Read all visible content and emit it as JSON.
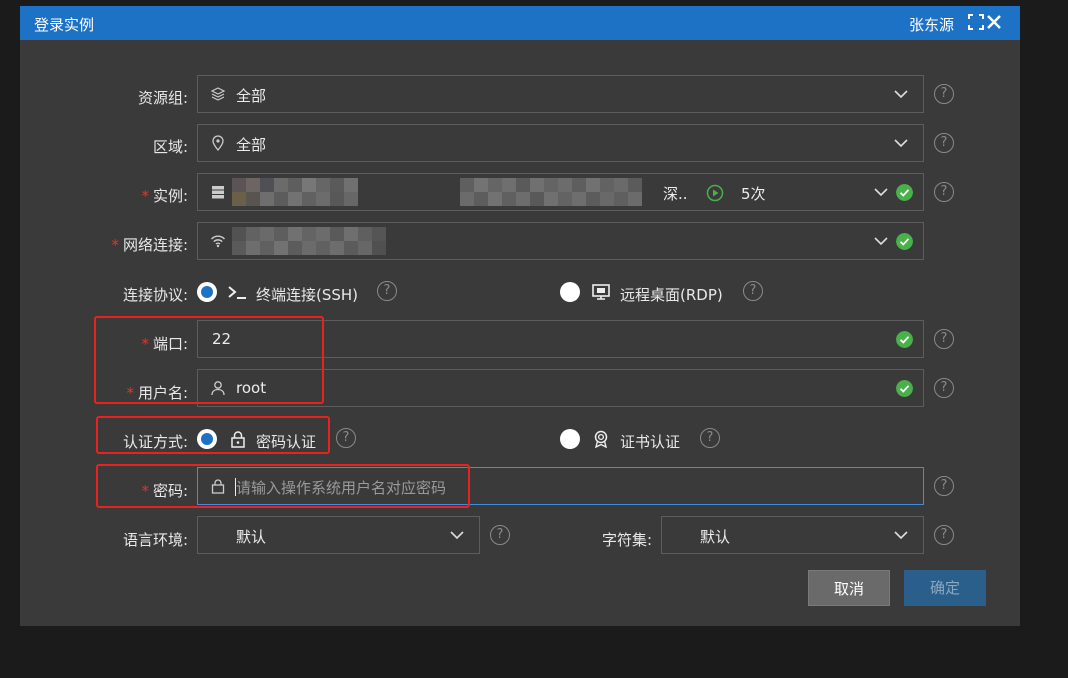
{
  "window": {
    "title": "登录实例",
    "user": "张东源"
  },
  "colors": {
    "titlebar": "#1d72c6",
    "required": "#e0352b",
    "valid": "#49b04a",
    "highlight": "#e8231f"
  },
  "form": {
    "resource_group": {
      "label": "资源组:",
      "value": "全部",
      "icon": "layers-icon"
    },
    "region": {
      "label": "区域:",
      "value": "全部",
      "icon": "map-pin-icon"
    },
    "instance": {
      "label": "实例:",
      "required_mark": "*",
      "region_text": "深..",
      "count_text": "5次",
      "icon": "server-icon"
    },
    "network": {
      "label": "网络连接:",
      "required_mark": "*",
      "icon": "wifi-icon"
    },
    "protocol": {
      "label": "连接协议:",
      "options": [
        {
          "label": "终端连接(SSH)",
          "selected": true,
          "icon": "terminal-icon"
        },
        {
          "label": "远程桌面(RDP)",
          "selected": false,
          "icon": "monitor-icon"
        }
      ]
    },
    "port": {
      "label": "端口:",
      "required_mark": "*",
      "value": "22"
    },
    "username": {
      "label": "用户名:",
      "required_mark": "*",
      "value": "root",
      "icon": "user-icon"
    },
    "auth": {
      "label": "认证方式:",
      "options": [
        {
          "label": "密码认证",
          "selected": true,
          "icon": "lock-icon"
        },
        {
          "label": "证书认证",
          "selected": false,
          "icon": "certificate-icon"
        }
      ]
    },
    "password": {
      "label": "密码:",
      "required_mark": "*",
      "placeholder": "请输入操作系统用户名对应密码",
      "icon": "lock-icon"
    },
    "locale": {
      "label": "语言环境:",
      "value": "默认"
    },
    "charset": {
      "label": "字符集:",
      "value": "默认"
    }
  },
  "buttons": {
    "cancel": "取消",
    "confirm": "确定"
  },
  "help_glyph": "?"
}
